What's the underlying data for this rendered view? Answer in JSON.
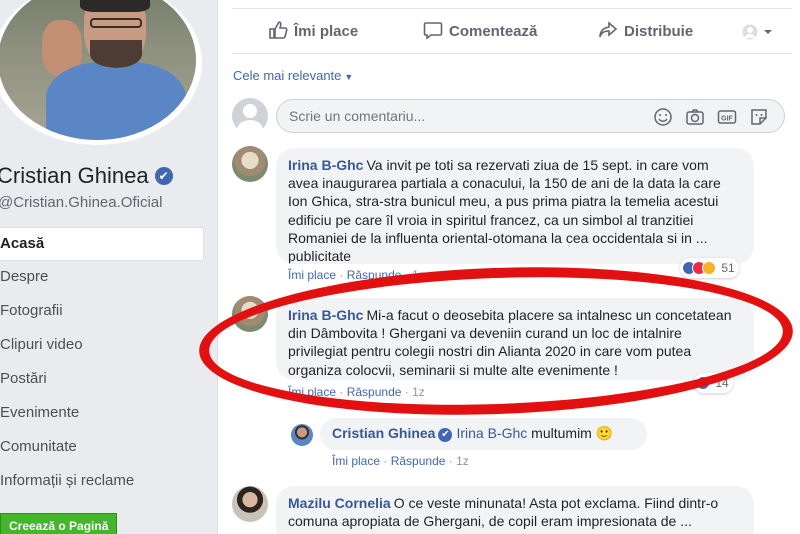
{
  "profile": {
    "name": "Cristian Ghinea",
    "handle": "@Cristian.Ghinea.Oficial"
  },
  "nav": {
    "items": [
      {
        "label": "Acasă",
        "active": true
      },
      {
        "label": "Despre"
      },
      {
        "label": "Fotografii"
      },
      {
        "label": "Clipuri video"
      },
      {
        "label": "Postări"
      },
      {
        "label": "Evenimente"
      },
      {
        "label": "Comunitate"
      },
      {
        "label": "Informații și reclame"
      }
    ],
    "create_page": "Creează o Pagină"
  },
  "actions": {
    "like": "Îmi place",
    "comment": "Comentează",
    "share": "Distribuie"
  },
  "sort": {
    "label": "Cele mai relevante"
  },
  "composer": {
    "placeholder": "Scrie un comentariu..."
  },
  "comments": [
    {
      "author": "Irina B-Ghc",
      "text": "Va invit pe toti sa rezervati ziua de 15 sept. in care vom avea inaugurarea partiala a conacului, la 150 de ani de la data la care Ion Ghica, stra-stra bunicul meu, a pus prima piatra la temelia acestui edificiu pe care îl vroia in spiritul francez, ca un simbol al tranzitiei Romaniei de la influenta oriental-otomana la cea occidentala si in ... publicitate",
      "like": "Îmi place",
      "reply": "Răspunde",
      "time": "1z",
      "reaction_count": "51"
    },
    {
      "author": "Irina B-Ghc",
      "text": "Mi-a facut o deosebita placere sa intalnesc un concetatean din Dâmbovita ! Ghergani va deveniin curand un loc de intalnire privilegiat pentru colegii nostri din Alianta 2020 in care vom putea organiza colocvii, seminarii si multe alte evenimente !",
      "like": "Îmi place",
      "reply": "Răspunde",
      "time": "1z",
      "reaction_count": "14"
    },
    {
      "author": "Cristian Ghinea",
      "mention": "Irina B-Ghc",
      "text": "multumim 🙂",
      "like": "Îmi place",
      "reply": "Răspunde",
      "time": "1z"
    },
    {
      "author": "Mazilu Cornelia",
      "text": "O ce veste minunata! Asta pot exclama. Fiind dintr-o comuna apropiata de Ghergani, de copil eram impresionata de ..."
    }
  ],
  "colors": {
    "link": "#385898",
    "accent": "#4267b2",
    "annotation": "#e21010",
    "create_page_bg": "#42b72a"
  }
}
